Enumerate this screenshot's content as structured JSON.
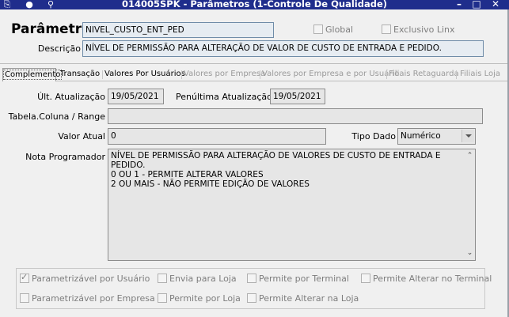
{
  "window": {
    "title": "014005SPK - Parâmetros (1-Controle De Qualidade)"
  },
  "header": {
    "parametro_label": "Parâmetro",
    "parametro_value": "NIVEL_CUSTO_ENT_PED",
    "global_label": "Global",
    "exclusivo_label": "Exclusivo Linx",
    "descricao_label": "Descrição",
    "descricao_value": "NÍVEL DE PERMISSÃO PARA ALTERAÇÃO DE VALOR DE CUSTO DE ENTRADA E PEDIDO."
  },
  "tabs": [
    {
      "label": "Complemento",
      "state": "active"
    },
    {
      "label": "Transação",
      "state": "enabled"
    },
    {
      "label": "Valores Por Usuários",
      "state": "enabled"
    },
    {
      "label": "Valores por Empresa",
      "state": "disabled"
    },
    {
      "label": "Valores por Empresa e por Usuário",
      "state": "disabled"
    },
    {
      "label": "Filiais Retaguarda",
      "state": "disabled"
    },
    {
      "label": "Filiais Loja",
      "state": "disabled"
    }
  ],
  "form": {
    "ult_atualizacao_label": "Últ. Atualização",
    "ult_atualizacao_value": "19/05/2021",
    "penultima_label": "Penúltima Atualização",
    "penultima_value": "19/05/2021",
    "tabela_label": "Tabela.Coluna / Range",
    "tabela_value": "",
    "valor_atual_label": "Valor Atual",
    "valor_atual_value": "0",
    "tipo_dado_label": "Tipo Dado",
    "tipo_dado_value": "Numérico",
    "nota_label": "Nota Programador",
    "nota_lines": [
      "NÍVEL DE PERMISSÃO PARA ALTERAÇÃO DE VALORES DE CUSTO DE ENTRADA E PEDIDO.",
      "0 OU 1 - PERMITE ALTERAR VALORES",
      "2 OU MAIS - NÃO PERMITE EDIÇÃO DE VALORES"
    ]
  },
  "options": {
    "parametrizavel_usuario": "Parametrizável por Usuário",
    "envia_loja": "Envia para Loja",
    "permite_terminal": "Permite por Terminal",
    "permite_alterar_terminal": "Permite Alterar no Terminal",
    "parametrizavel_empresa": "Parametrizável por Empresa",
    "permite_loja": "Permite por Loja",
    "permite_alterar_loja": "Permite Alterar na Loja"
  }
}
